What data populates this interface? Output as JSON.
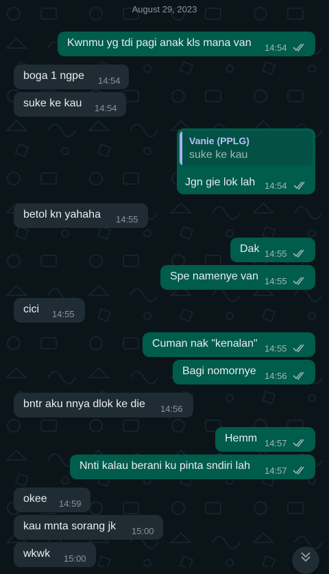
{
  "date_label": "August 29, 2023",
  "messages": [
    {
      "text": "Kwnmu yg tdi pagi anak kls mana van",
      "time": "14:54",
      "ticks": "double-check-icon"
    },
    {
      "text": "boga 1 ngpe",
      "time": "14:54"
    },
    {
      "text": "suke ke kau",
      "time": "14:54"
    },
    {
      "quote_author": "Vanie (PPLG)",
      "quote_text": "suke ke kau",
      "text": "Jgn gie lok lah",
      "time": "14:54",
      "ticks": "double-check-icon"
    },
    {
      "text": "betol kn yahaha",
      "time": "14:55"
    },
    {
      "text": "Dak",
      "time": "14:55",
      "ticks": "double-check-icon"
    },
    {
      "text": "Spe namenye van",
      "time": "14:55",
      "ticks": "double-check-icon"
    },
    {
      "text": "cici",
      "time": "14:55"
    },
    {
      "text": "Cuman nak \"kenalan\"",
      "time": "14:55",
      "ticks": "double-check-icon"
    },
    {
      "text": "Bagi nomornye",
      "time": "14:56",
      "ticks": "double-check-icon"
    },
    {
      "text": "bntr aku nnya dlok ke die",
      "time": "14:56"
    },
    {
      "text": "Hemm",
      "time": "14:57",
      "ticks": "double-check-icon"
    },
    {
      "text": "Nnti kalau berani ku pinta sndiri lah",
      "time": "14:57",
      "ticks": "double-check-icon"
    },
    {
      "text": "okee",
      "time": "14:59"
    },
    {
      "text": "kau mnta sorang jk",
      "time": "15:00"
    },
    {
      "text": "wkwk",
      "time": "15:00"
    }
  ],
  "colors": {
    "background": "#0b1419",
    "incoming_bubble": "#1f2c33",
    "outgoing_bubble": "#005c4b",
    "text": "#e9edef",
    "quote_author": "#b8c1f9"
  },
  "scroll_button_icon": "double-chevron-down-icon"
}
